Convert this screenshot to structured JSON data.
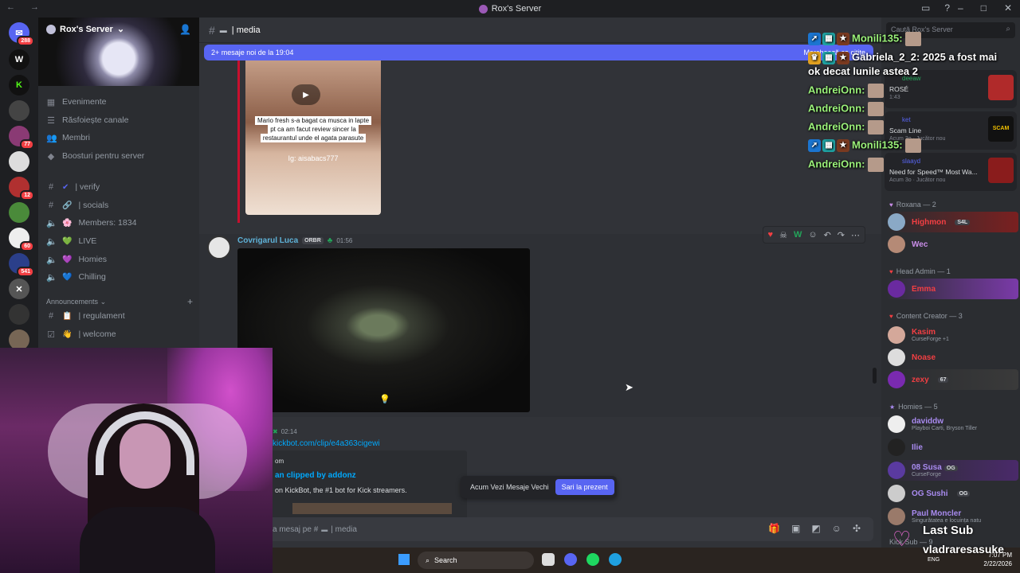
{
  "titlebar": {
    "title": "Rox's Server"
  },
  "server": {
    "name": "Rox's Server",
    "badges": {
      "home": "288",
      "s9": "77",
      "s15": "12",
      "s19": "60",
      "s21": "541"
    }
  },
  "sidebar": {
    "nav": [
      {
        "label": "Evenimente",
        "icon": "calendar-icon"
      },
      {
        "label": "Răsfoiește canale",
        "icon": "browse-icon"
      },
      {
        "label": "Membri",
        "icon": "members-icon"
      },
      {
        "label": "Boosturi pentru server",
        "icon": "boost-icon"
      }
    ],
    "channels": [
      {
        "label": "| verify",
        "emoji": "✔"
      },
      {
        "label": "| socials",
        "emoji": "🔗"
      },
      {
        "label": "Members: 1834",
        "emoji": "🌸"
      },
      {
        "label": "LIVE",
        "emoji": "💚"
      },
      {
        "label": "Homies",
        "emoji": "💜"
      },
      {
        "label": "Chilling",
        "emoji": "💙"
      }
    ],
    "category": "Announcements",
    "announce_channels": [
      {
        "label": "| regulament",
        "emoji": "📋"
      },
      {
        "label": "| welcome",
        "emoji": "👋"
      }
    ]
  },
  "chat": {
    "channel": "| media",
    "new_messages_bar": "2+ mesaje noi de la 19:04",
    "mark_read": "Marchează ca citite",
    "thumb_caption": "Mario fresh s-a bagat ca musca in lapte pt ca am facut review sincer la restaurantul unde el agata parasute",
    "thumb_ig": "Ig: aisabacs777",
    "msg2": {
      "author": "Covrigarul Luca",
      "tag": "ORBR",
      "time": "01:56"
    },
    "msg3": {
      "time": "02:14",
      "link": "kickbot.com/clip/e4a363cigewi",
      "embed_site": "om",
      "embed_title": "an clipped by addonz",
      "embed_desc": "on KickBot, the #1 bot for Kick streamers."
    },
    "jump_text": "Acum Vezi Mesaje Vechi",
    "jump_button": "Sari la prezent",
    "composer_placeholder": "a mesaj pe #",
    "composer_channel": "| media"
  },
  "overlay_chat": [
    {
      "name": "Monili135:",
      "text": ""
    },
    {
      "name": "Gabriela_2_2:",
      "text": "2025 a fost mai"
    },
    {
      "name": "",
      "text": "ok decat lunile astea 2"
    },
    {
      "name": "AndreiOnn:",
      "text": ""
    },
    {
      "name": "AndreiOnn:",
      "text": ""
    },
    {
      "name": "AndreiOnn:",
      "text": ""
    },
    {
      "name": "Monili135:",
      "text": ""
    },
    {
      "name": "AndreiOnn:",
      "text": ""
    }
  ],
  "members": {
    "search_placeholder": "Caută Rox's Server",
    "activities": [
      {
        "name": "deeaw",
        "title": "ROSÉ",
        "status": "1:43"
      },
      {
        "name": "ket",
        "title": "Scam Line",
        "status": "Acum 3o · Jucător nou"
      },
      {
        "name": "slaayd",
        "title": "Need for Speed™ Most Wa...",
        "status": "Acum 3o · Jucător nou"
      }
    ],
    "groups": [
      {
        "label": "Roxana — 2",
        "members": [
          {
            "name": "Highmon",
            "sub": "",
            "pill": "S4L",
            "color": "#f23f43"
          },
          {
            "name": "Wec",
            "sub": "",
            "pill": "",
            "color": "#c98de8"
          }
        ]
      },
      {
        "label": "Head Admin — 1",
        "members": [
          {
            "name": "Emma",
            "sub": "",
            "pill": "",
            "color": "#f23f43"
          }
        ]
      },
      {
        "label": "Content Creator — 3",
        "members": [
          {
            "name": "Kasim",
            "sub": "CurseForge +1",
            "pill": "",
            "color": "#f23f43"
          },
          {
            "name": "Noase",
            "sub": "",
            "pill": "",
            "color": "#f23f43"
          },
          {
            "name": "zexy",
            "sub": "",
            "pill": "67",
            "color": "#f23f43"
          }
        ]
      },
      {
        "label": "Homies — 5",
        "members": [
          {
            "name": "daviddw",
            "sub": "Playboi Carti, Bryson Tiller",
            "pill": "",
            "color": "#a98bf0"
          },
          {
            "name": "Ilie",
            "sub": "",
            "pill": "",
            "color": "#a98bf0"
          },
          {
            "name": "08 Susa",
            "sub": "CurseForge",
            "pill": "OG",
            "color": "#a98bf0"
          },
          {
            "name": "OG Sushi",
            "sub": "",
            "pill": "OG",
            "color": "#a98bf0"
          },
          {
            "name": "Paul Moncler",
            "sub": "Singurătatea e locuința natu",
            "pill": "",
            "color": "#a98bf0"
          }
        ]
      }
    ],
    "kick_sub": "Kick Sub — 9"
  },
  "last_sub": {
    "label": "Last Sub",
    "name": "vladraresasuke"
  },
  "taskbar": {
    "search": "Search",
    "lang": "ENG",
    "time": "7:07 PM",
    "date": "2/22/2026"
  }
}
